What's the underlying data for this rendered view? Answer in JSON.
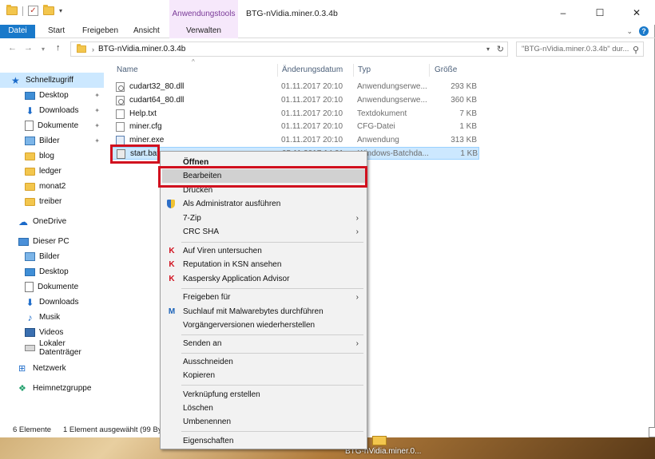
{
  "window": {
    "title": "BTG-nVidia.miner.0.3.4b",
    "contextual_group": "Anwendungstools",
    "controls": {
      "minimize": "–",
      "maximize": "☐",
      "close": "✕"
    }
  },
  "ribbon": {
    "tabs": [
      "Datei",
      "Start",
      "Freigeben",
      "Ansicht",
      "Verwalten"
    ],
    "expand": "⌄",
    "help": "?"
  },
  "address": {
    "path": "BTG-nVidia.miner.0.3.4b",
    "search_placeholder": "\"BTG-nVidia.miner.0.3.4b\" dur..."
  },
  "nav": {
    "quick_access": "Schnellzugriff",
    "quick_items": [
      "Desktop",
      "Downloads",
      "Dokumente",
      "Bilder",
      "blog",
      "ledger",
      "monat2",
      "treiber"
    ],
    "onedrive": "OneDrive",
    "this_pc": "Dieser PC",
    "pc_items": [
      "Bilder",
      "Desktop",
      "Dokumente",
      "Downloads",
      "Musik",
      "Videos",
      "Lokaler Datenträger"
    ],
    "network": "Netzwerk",
    "homegroup": "Heimnetzgruppe"
  },
  "columns": {
    "name": "Name",
    "date": "Änderungsdatum",
    "type": "Typ",
    "size": "Größe"
  },
  "files": [
    {
      "name": "cudart32_80.dll",
      "date": "01.11.2017 20:10",
      "type": "Anwendungserwe...",
      "size": "293 KB",
      "icon": "dll"
    },
    {
      "name": "cudart64_80.dll",
      "date": "01.11.2017 20:10",
      "type": "Anwendungserwe...",
      "size": "360 KB",
      "icon": "dll"
    },
    {
      "name": "Help.txt",
      "date": "01.11.2017 20:10",
      "type": "Textdokument",
      "size": "7 KB",
      "icon": "txt"
    },
    {
      "name": "miner.cfg",
      "date": "01.11.2017 20:10",
      "type": "CFG-Datei",
      "size": "1 KB",
      "icon": "cfg"
    },
    {
      "name": "miner.exe",
      "date": "01.11.2017 20:10",
      "type": "Anwendung",
      "size": "313 KB",
      "icon": "exe"
    },
    {
      "name": "start.bat",
      "date": "05.11.2017 14:01",
      "type": "Windows-Batchda...",
      "size": "1 KB",
      "icon": "bat"
    }
  ],
  "status": {
    "count": "6 Elemente",
    "selection": "1 Element ausgewählt (99 Bytes)"
  },
  "context_menu": {
    "open": "Öffnen",
    "edit": "Bearbeiten",
    "print": "Drucken",
    "run_as_admin": "Als Administrator ausführen",
    "zip": "7-Zip",
    "crc": "CRC SHA",
    "scan": "Auf Viren untersuchen",
    "ksn": "Reputation in KSN ansehen",
    "kav": "Kaspersky Application Advisor",
    "share": "Freigeben für",
    "malwarebytes": "Suchlauf mit Malwarebytes durchführen",
    "restore": "Vorgängerversionen wiederherstellen",
    "send_to": "Senden an",
    "cut": "Ausschneiden",
    "copy": "Kopieren",
    "shortcut": "Verknüpfung erstellen",
    "delete": "Löschen",
    "rename": "Umbenennen",
    "properties": "Eigenschaften"
  },
  "desktop": {
    "label": "BTG-nVidia.miner.0..."
  },
  "colors": {
    "accent": "#1979ca",
    "highlight": "#d1101e",
    "selection": "#cce8ff"
  }
}
